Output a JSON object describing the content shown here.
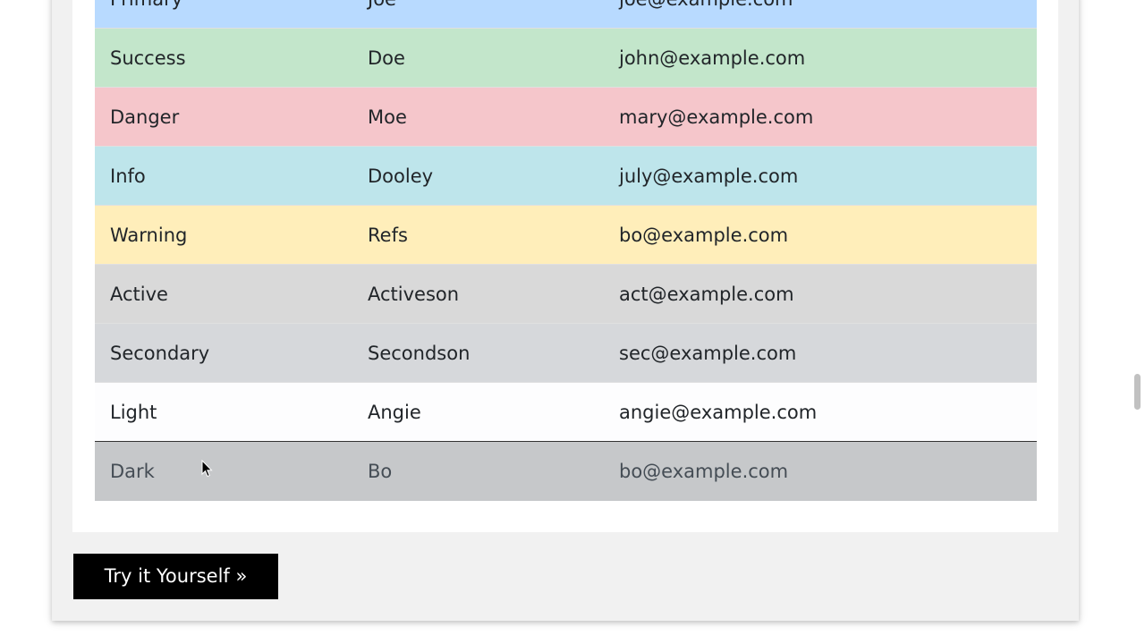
{
  "table": {
    "rows": [
      {
        "variant": "primary",
        "bg": "#b8daff",
        "cells": [
          "Primary",
          "Joe",
          "joe@example.com"
        ]
      },
      {
        "variant": "success",
        "bg": "#c3e6cb",
        "cells": [
          "Success",
          "Doe",
          "john@example.com"
        ]
      },
      {
        "variant": "danger",
        "bg": "#f5c6cb",
        "cells": [
          "Danger",
          "Moe",
          "mary@example.com"
        ]
      },
      {
        "variant": "info",
        "bg": "#bee5eb",
        "cells": [
          "Info",
          "Dooley",
          "july@example.com"
        ]
      },
      {
        "variant": "warning",
        "bg": "#ffeeba",
        "cells": [
          "Warning",
          "Refs",
          "bo@example.com"
        ]
      },
      {
        "variant": "active",
        "bg": "#d9d9d9",
        "cells": [
          "Active",
          "Activeson",
          "act@example.com"
        ]
      },
      {
        "variant": "secondary",
        "bg": "#d6d8db",
        "cells": [
          "Secondary",
          "Secondson",
          "sec@example.com"
        ]
      },
      {
        "variant": "light",
        "bg": "#fdfdfe",
        "cells": [
          "Light",
          "Angie",
          "angie@example.com"
        ]
      },
      {
        "variant": "dark",
        "bg": "#c6c8ca",
        "cells": [
          "Dark",
          "Bo",
          "bo@example.com"
        ]
      }
    ]
  },
  "try_button": {
    "label": "Try it Yourself »"
  },
  "icons": {
    "cursor": "mouse-pointer-icon"
  },
  "colors": {
    "panel_bg": "#f1f1f1",
    "button_bg": "#000000",
    "button_text": "#ffffff"
  }
}
